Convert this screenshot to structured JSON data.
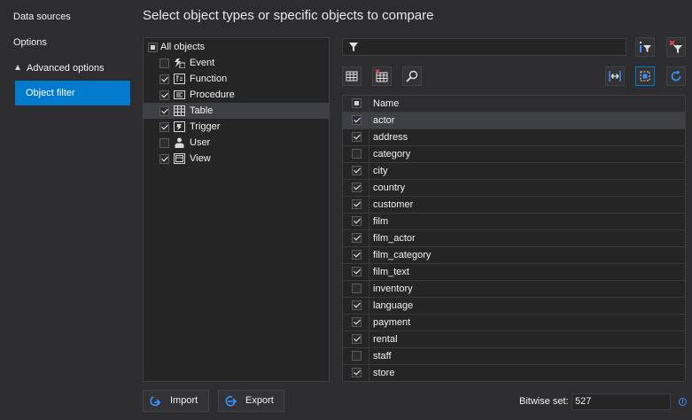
{
  "sidebar": {
    "items": [
      {
        "label": "Data sources"
      },
      {
        "label": "Options"
      },
      {
        "label": "Advanced options"
      },
      {
        "label": "Object filter"
      }
    ]
  },
  "heading": "Select object types or specific objects  to compare",
  "types": {
    "all_label": "All objects",
    "items": [
      {
        "label": "Event",
        "checked": false,
        "icon": "event-icon"
      },
      {
        "label": "Function",
        "checked": true,
        "icon": "function-icon"
      },
      {
        "label": "Procedure",
        "checked": true,
        "icon": "procedure-icon"
      },
      {
        "label": "Table",
        "checked": true,
        "icon": "table-icon",
        "selected": true
      },
      {
        "label": "Trigger",
        "checked": true,
        "icon": "trigger-icon"
      },
      {
        "label": "User",
        "checked": false,
        "icon": "user-icon"
      },
      {
        "label": "View",
        "checked": true,
        "icon": "view-icon"
      }
    ]
  },
  "filter": {
    "value": "",
    "icon": "filter-icon"
  },
  "list": {
    "header": "Name",
    "rows": [
      {
        "name": "actor",
        "checked": true,
        "selected": true
      },
      {
        "name": "address",
        "checked": true
      },
      {
        "name": "category",
        "checked": false
      },
      {
        "name": "city",
        "checked": true
      },
      {
        "name": "country",
        "checked": true
      },
      {
        "name": "customer",
        "checked": true
      },
      {
        "name": "film",
        "checked": true
      },
      {
        "name": "film_actor",
        "checked": true
      },
      {
        "name": "film_category",
        "checked": true
      },
      {
        "name": "film_text",
        "checked": true
      },
      {
        "name": "inventory",
        "checked": false
      },
      {
        "name": "language",
        "checked": true
      },
      {
        "name": "payment",
        "checked": true
      },
      {
        "name": "rental",
        "checked": true
      },
      {
        "name": "staff",
        "checked": false
      },
      {
        "name": "store",
        "checked": true
      }
    ]
  },
  "buttons": {
    "import": "Import",
    "export": "Export"
  },
  "bitwise": {
    "label": "Bitwise set:",
    "value": "527"
  },
  "colors": {
    "accent": "#007acc",
    "background": "#2d2d30",
    "panel": "#252526"
  }
}
